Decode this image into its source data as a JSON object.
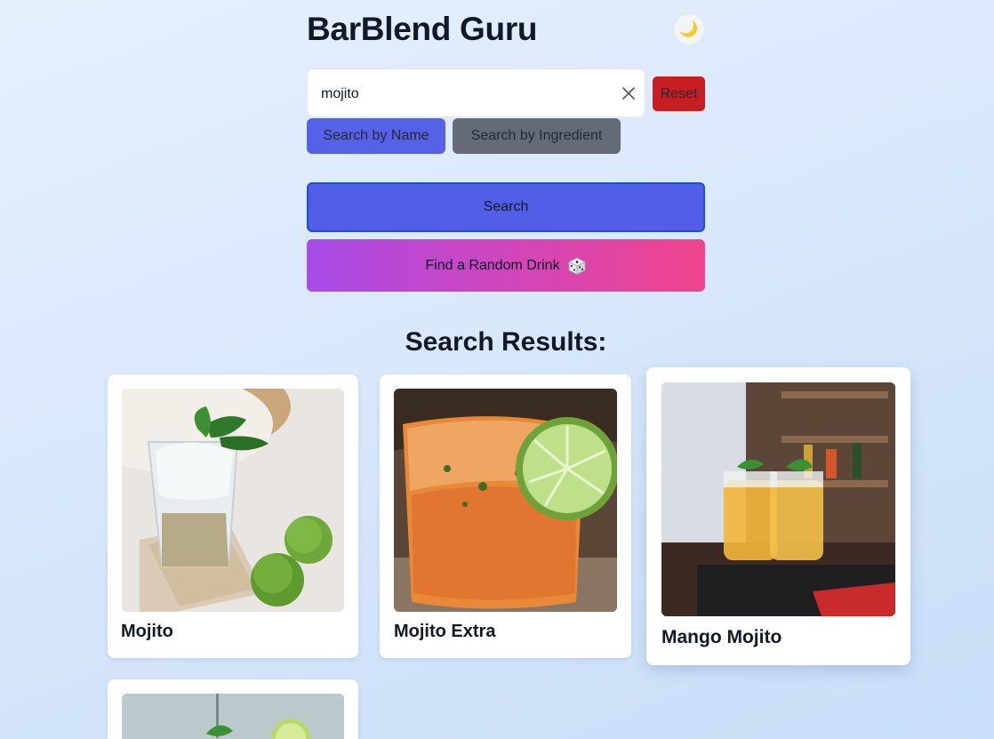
{
  "app": {
    "title": "BarBlend Guru"
  },
  "theme_toggle": {
    "icon": "moon-icon",
    "glyph": "🌙"
  },
  "search": {
    "value": "mojito",
    "placeholder": "",
    "reset_label": "Reset"
  },
  "modes": [
    {
      "label": "Search by Name",
      "active": true
    },
    {
      "label": "Search by Ingredient",
      "active": false
    }
  ],
  "actions": {
    "search_label": "Search",
    "random_label": "Find a Random Drink",
    "random_icon": "dice-icon"
  },
  "results": {
    "heading": "Search Results:",
    "items": [
      {
        "name": "Mojito"
      },
      {
        "name": "Mojito Extra"
      },
      {
        "name": "Mango Mojito"
      },
      {
        "name": ""
      }
    ]
  },
  "colors": {
    "primary": "#535ee8",
    "reset": "#c51f24",
    "secondary": "#646b76",
    "gradient_start": "#a84be8",
    "gradient_end": "#f0458d"
  }
}
